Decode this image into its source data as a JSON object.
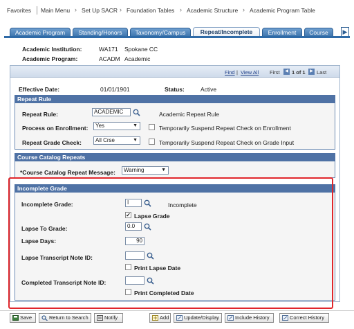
{
  "breadcrumb": {
    "items": [
      "Favorites",
      "Main Menu",
      "Set Up SACR",
      "Foundation Tables",
      "Academic Structure",
      "Academic Program Table"
    ]
  },
  "tabs": [
    "Academic Program",
    "Standing/Honors",
    "Taxonomy/Campus",
    "Repeat/Incomplete",
    "Enrollment",
    "Course"
  ],
  "active_tab": "Repeat/Incomplete",
  "header": {
    "institution_label": "Academic Institution:",
    "institution_code": "WA171",
    "institution_name": "Spokane CC",
    "program_label": "Academic Program:",
    "program_code": "ACADM",
    "program_name": "Academic"
  },
  "nav": {
    "find": "Find",
    "separator": "|",
    "view_all": "View All",
    "first": "First",
    "count": "1 of 1",
    "last": "Last"
  },
  "effective": {
    "date_label": "Effective Date:",
    "date_value": "01/01/1901",
    "status_label": "Status:",
    "status_value": "Active"
  },
  "repeat_rule": {
    "section_title": "Repeat Rule",
    "rule_label": "Repeat Rule:",
    "rule_value": "ACADEMIC",
    "rule_desc": "Academic Repeat Rule",
    "process_label": "Process on Enrollment:",
    "process_value": "Yes",
    "suspend_enroll_label": "Temporarily Suspend Repeat Check on Enrollment",
    "grade_check_label": "Repeat Grade Check:",
    "grade_check_value": "All Crse",
    "suspend_grade_label": "Temporarily Suspend Repeat Check on Grade Input"
  },
  "catalog_repeats": {
    "section_title": "Course Catalog Repeats",
    "message_label": "*Course Catalog Repeat Message:",
    "message_value": "Warning"
  },
  "incomplete_grade": {
    "section_title": "Incomplete Grade",
    "grade_label": "Incomplete Grade:",
    "grade_value": "I",
    "grade_desc": "Incomplete",
    "lapse_grade_label": "Lapse Grade",
    "lapse_to_label": "Lapse To Grade:",
    "lapse_to_value": "0.0",
    "lapse_days_label": "Lapse Days:",
    "lapse_days_value": "90",
    "lapse_note_label": "Lapse Transcript Note ID:",
    "lapse_note_value": "",
    "print_lapse_label": "Print Lapse Date",
    "completed_note_label": "Completed Transcript Note ID:",
    "completed_note_value": "",
    "print_completed_label": "Print Completed Date"
  },
  "toolbar": {
    "save": "Save",
    "return": "Return to Search",
    "notify": "Notify",
    "add": "Add",
    "update": "Update/Display",
    "include_history": "Include History",
    "correct_history": "Correct History"
  },
  "colors": {
    "tab_blue": "#3d74ad",
    "section_header": "#4f72a5",
    "highlight_red": "#e0262b"
  }
}
